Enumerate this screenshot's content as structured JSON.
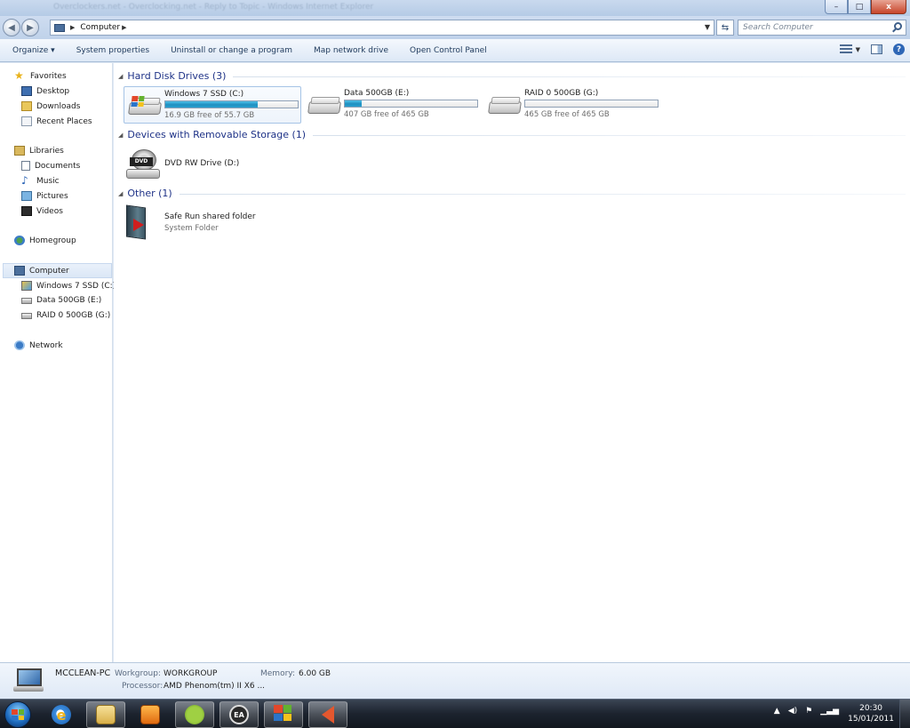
{
  "window": {
    "title_bar_text": "Overclockers.net - Overclocking.net - Reply to Topic - Windows Internet Explorer",
    "buttons": {
      "minimize": "–",
      "maximize": "□",
      "close": "x"
    }
  },
  "address_bar": {
    "breadcrumb": [
      "Computer"
    ],
    "search_placeholder": "Search Computer"
  },
  "command_bar": {
    "items": [
      "Organize ▾",
      "System properties",
      "Uninstall or change a program",
      "Map network drive",
      "Open Control Panel"
    ]
  },
  "nav_pane": {
    "favorites": {
      "label": "Favorites",
      "items": [
        "Desktop",
        "Downloads",
        "Recent Places"
      ]
    },
    "libraries": {
      "label": "Libraries",
      "items": [
        "Documents",
        "Music",
        "Pictures",
        "Videos"
      ]
    },
    "homegroup": {
      "label": "Homegroup"
    },
    "computer": {
      "label": "Computer",
      "items": [
        "Windows 7 SSD (C:)",
        "Data 500GB (E:)",
        "RAID 0 500GB (G:)"
      ]
    },
    "network": {
      "label": "Network"
    }
  },
  "content": {
    "hard_disk_drives": {
      "title": "Hard Disk Drives (3)",
      "drives": [
        {
          "name": "Windows 7 SSD (C:)",
          "free_text": "16.9 GB free of 55.7 GB",
          "used_fraction": 0.697
        },
        {
          "name": "Data 500GB (E:)",
          "free_text": "407 GB free of 465 GB",
          "used_fraction": 0.125
        },
        {
          "name": "RAID 0 500GB (G:)",
          "free_text": "465 GB free of 465 GB",
          "used_fraction": 0.0
        }
      ]
    },
    "removable": {
      "title": "Devices with Removable Storage (1)",
      "items": [
        {
          "name": "DVD RW Drive (D:)",
          "icon_label": "DVD"
        }
      ]
    },
    "other": {
      "title": "Other (1)",
      "items": [
        {
          "name": "Safe Run shared folder",
          "type": "System Folder"
        }
      ]
    }
  },
  "details_pane": {
    "computer_name": "MCCLEAN-PC",
    "workgroup_label": "Workgroup:",
    "workgroup_value": "WORKGROUP",
    "memory_label": "Memory:",
    "memory_value": "6.00 GB",
    "processor_label": "Processor:",
    "processor_value": "AMD Phenom(tm) II X6 ..."
  },
  "taskbar": {
    "pinned": [
      "internet-explorer",
      "windows-explorer",
      "media-player",
      "spotify",
      "ea",
      "windows-live",
      "sound-app"
    ],
    "ea_label": "EA",
    "tray_icons": [
      "show-hidden-icons",
      "volume",
      "action-center",
      "network-signal"
    ],
    "time": "20:30",
    "date": "15/01/2011"
  }
}
